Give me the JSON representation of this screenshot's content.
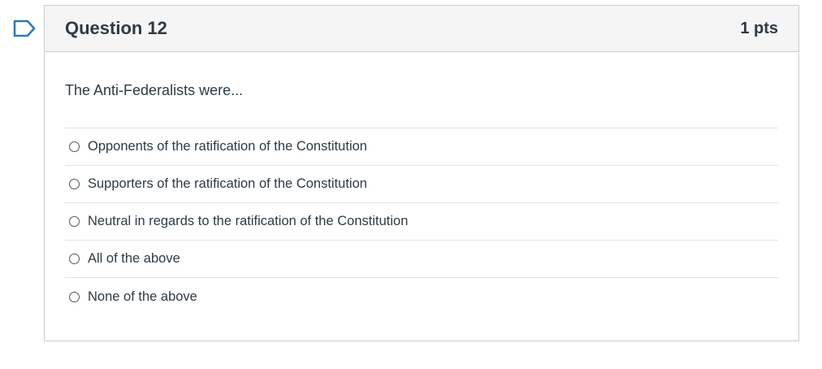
{
  "question": {
    "title": "Question 12",
    "points": "1 pts",
    "text": "The Anti-Federalists were...",
    "answers": [
      {
        "label": "Opponents of the ratification of the Constitution"
      },
      {
        "label": "Supporters of the ratification of the Constitution"
      },
      {
        "label": "Neutral in regards to the ratification of the Constitution"
      },
      {
        "label": "All of the above"
      },
      {
        "label": "None of the above"
      }
    ]
  },
  "colors": {
    "flag": "#2b7abc",
    "header_bg": "#f5f5f5",
    "border": "#c7cdd1",
    "text": "#2d3b45"
  },
  "icons": {
    "flag": "flag-question-icon",
    "radio": "radio-unselected-icon"
  }
}
